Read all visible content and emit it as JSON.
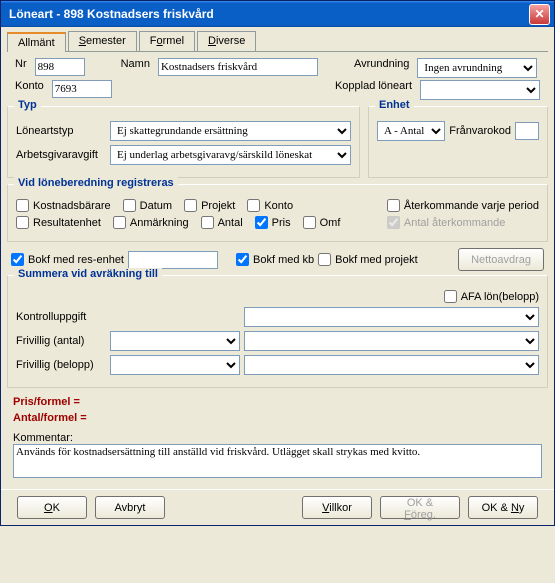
{
  "title": "Löneart - 898  Kostnadsers friskvård",
  "tabs": {
    "t0": "Allmänt",
    "t1": "Semester",
    "t2": "Formel",
    "t3": "Diverse"
  },
  "top": {
    "nr_lbl": "Nr",
    "nr_val": "898",
    "namn_lbl": "Namn",
    "namn_val": "Kostnadsers friskvård",
    "avr_lbl": "Avrundning",
    "avr_val": "Ingen avrundning",
    "konto_lbl": "Konto",
    "konto_val": "7693",
    "kopp_lbl": "Kopplad löneart",
    "kopp_val": ""
  },
  "typ": {
    "legend": "Typ",
    "lat_lbl": "Löneartstyp",
    "lat_val": "Ej skattegrundande ersättning",
    "arb_lbl": "Arbetsgivaravgift",
    "arb_val": "Ej underlag arbetsgivaravg/särskild löneskat"
  },
  "enhet": {
    "legend": "Enhet",
    "enhet_val": "A - Antal",
    "fkod_lbl": "Frånvarokod",
    "fkod_val": ""
  },
  "reg": {
    "legend": "Vid löneberedning registreras",
    "c0": "Kostnadsbärare",
    "c1": "Datum",
    "c2": "Projekt",
    "c3": "Konto",
    "c4": "Resultatenhet",
    "c5": "Anmärkning",
    "c6": "Antal",
    "c7": "Pris",
    "c8": "Omf",
    "r0": "Återkommande varje period",
    "r1": "Antal återkommande"
  },
  "mid": {
    "bre": "Bokf med res-enhet",
    "bre_val": "",
    "bkb": "Bokf med kb",
    "bpr": "Bokf med projekt",
    "netto": "Nettoavdrag"
  },
  "sum": {
    "legend": "Summera vid avräkning till",
    "afa": "AFA lön(belopp)",
    "ku_lbl": "Kontrolluppgift",
    "fa_lbl": "Frivillig (antal)",
    "fb_lbl": "Frivillig (belopp)"
  },
  "pris": "Pris/formel =",
  "antal": "Antal/formel =",
  "komm_lbl": "Kommentar:",
  "komm_val": "Används för kostnadsersättning till anställd vid friskvård. Utlägget skall strykas med kvitto.",
  "btns": {
    "ok": "OK",
    "avbryt": "Avbryt",
    "villkor": "Villkor",
    "okforeg": "OK & Föreg.",
    "okny": "OK & Ny"
  }
}
